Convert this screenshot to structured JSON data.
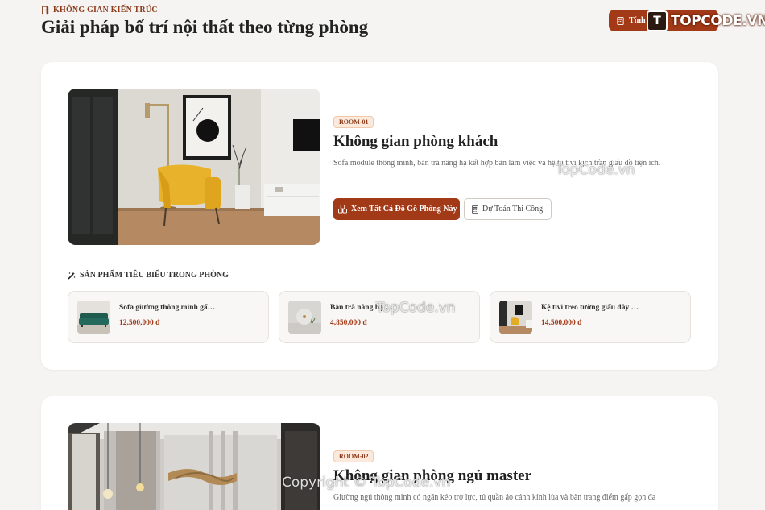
{
  "header": {
    "eyebrow": "KHÔNG GIAN KIẾN TRÚC",
    "title": "Giải pháp bố trí nội thất theo từng phòng",
    "top_button": "Tính"
  },
  "watermarks": {
    "logo_badge": "T",
    "logo_text": "TOPCODE.VN",
    "topcode1": "TopCode.vn",
    "topcode2": "TopCode.vn",
    "copyright": "Copyright © TopCode.vn"
  },
  "rooms": [
    {
      "badge": "ROOM-01",
      "title": "Không gian phòng khách",
      "description": "Sofa module thông minh, bàn trà nâng hạ kết hợp bàn làm việc và hệ tủ tivi kịch trần giấu đồ tiện ích.",
      "primary_button": "Xem Tất Cả Đồ Gỗ Phòng Này",
      "secondary_button": "Dự Toán Thi Công",
      "section_label": "SẢN PHẨM TIÊU BIỂU TRONG PHÒNG",
      "products": [
        {
          "name": "Sofa giường thông minh gấ…",
          "price": "12,500,000 đ"
        },
        {
          "name": "Bàn trà nâng hạ …",
          "price": "4,850,000 đ"
        },
        {
          "name": "Kệ tivi treo tường giấu dây …",
          "price": "14,500,000 đ"
        }
      ]
    },
    {
      "badge": "ROOM-02",
      "title": "Không gian phòng ngủ master",
      "description": "Giường ngủ thông minh có ngăn kéo trợ lực, tủ quần áo cánh kính lùa và bàn trang điểm gấp gọn đa"
    }
  ],
  "colors": {
    "accent": "#a23a18",
    "badge_bg": "#fbe9dc",
    "page_bg": "#f5f4f2"
  }
}
